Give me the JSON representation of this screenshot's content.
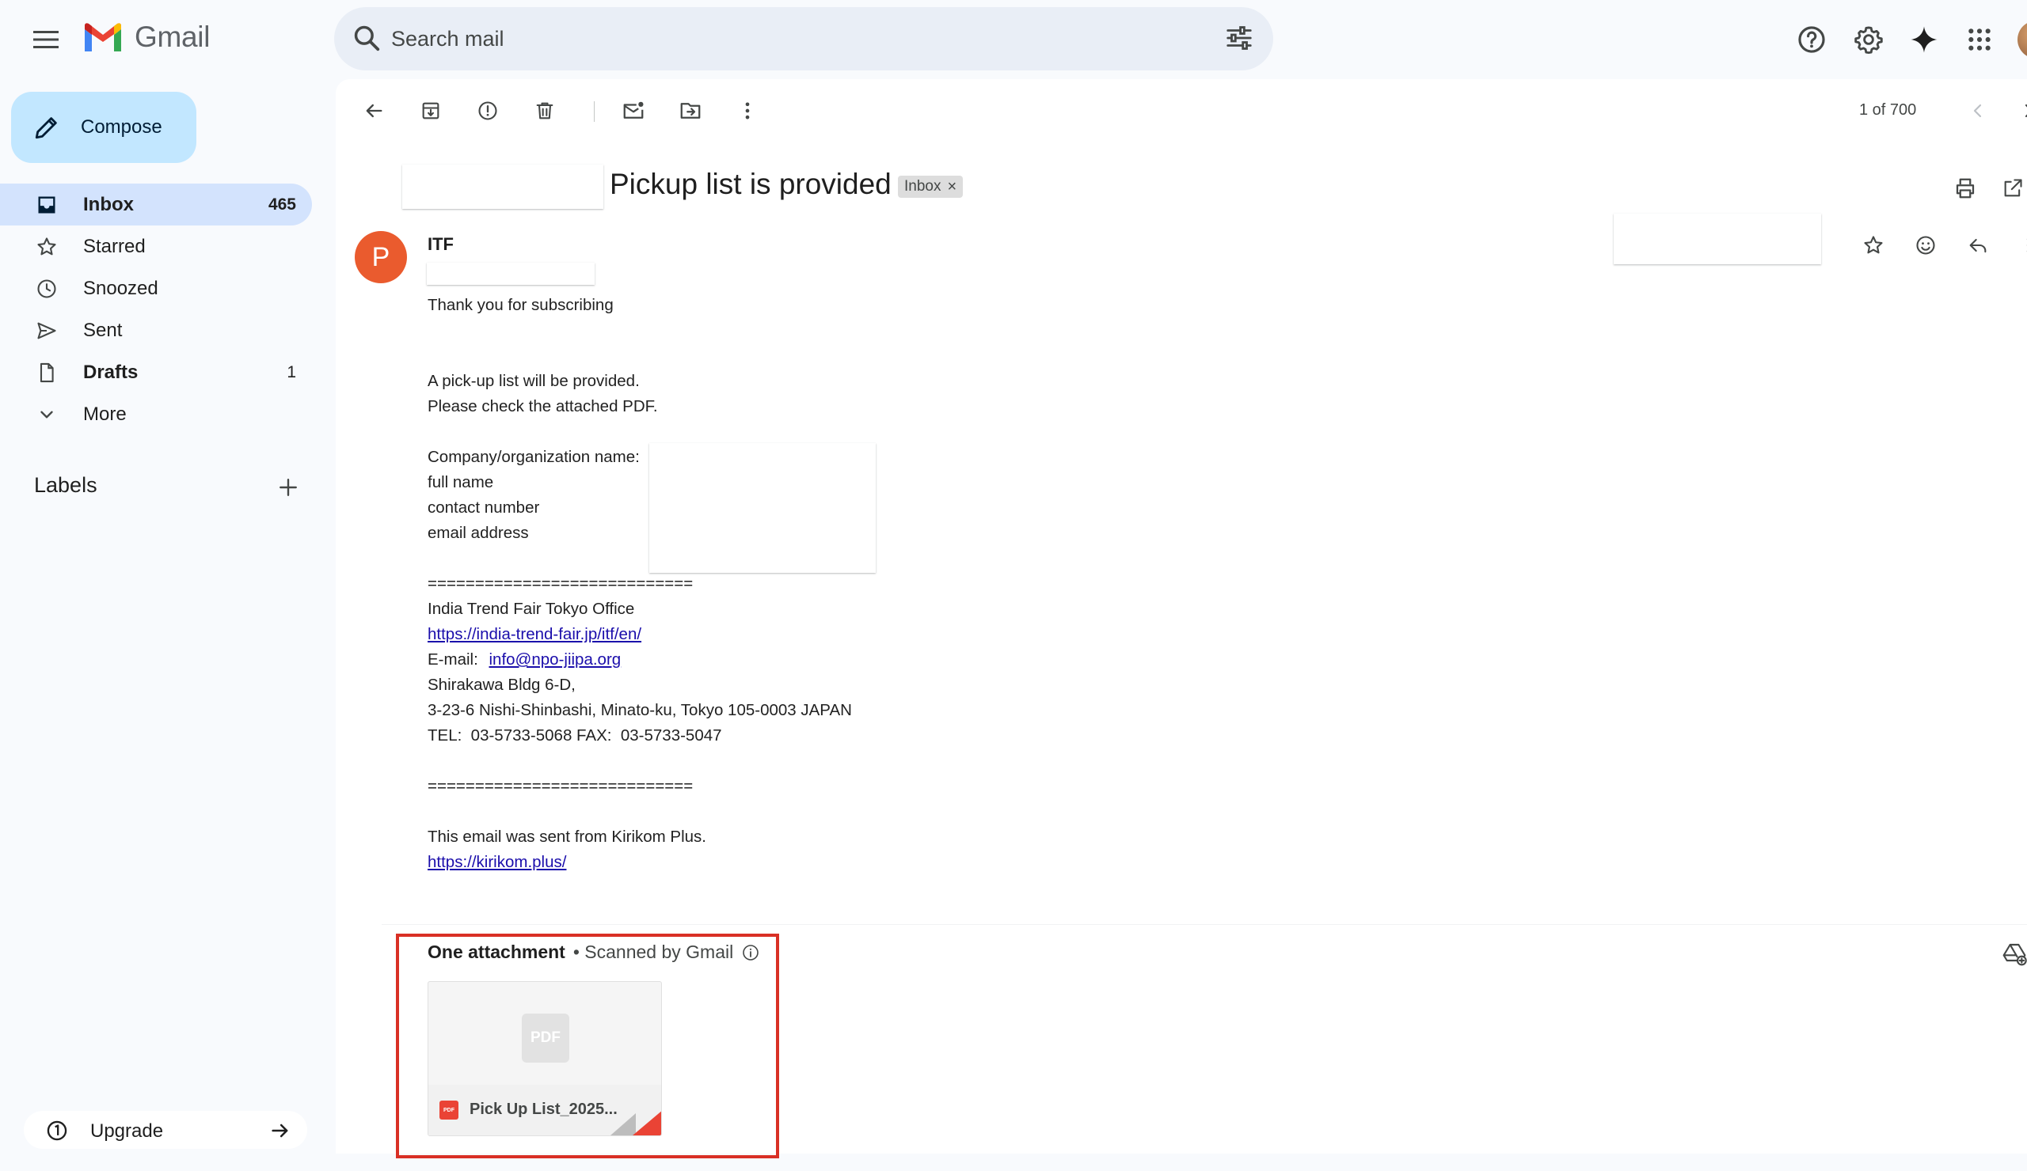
{
  "app": {
    "name": "Gmail"
  },
  "search": {
    "placeholder": "Search mail"
  },
  "sidebar": {
    "compose_label": "Compose",
    "items": [
      {
        "label": "Inbox",
        "count": "465",
        "icon": "inbox-icon"
      },
      {
        "label": "Starred",
        "count": "",
        "icon": "star-icon"
      },
      {
        "label": "Snoozed",
        "count": "",
        "icon": "clock-icon"
      },
      {
        "label": "Sent",
        "count": "",
        "icon": "send-icon"
      },
      {
        "label": "Drafts",
        "count": "1",
        "icon": "draft-icon"
      },
      {
        "label": "More",
        "count": "",
        "icon": "chevron-down-icon"
      }
    ],
    "labels_title": "Labels",
    "upgrade_label": "Upgrade"
  },
  "toolbar": {
    "pager": "1 of 700",
    "icons": [
      "back-arrow-icon",
      "archive-icon",
      "report-spam-icon",
      "delete-icon",
      "mark-unread-icon",
      "move-to-icon",
      "more-vert-icon",
      "prev-icon",
      "next-icon"
    ]
  },
  "email": {
    "subject": "Pickup list is provided",
    "label_chip": "Inbox",
    "chip_close": "×",
    "sender_initial": "P",
    "sender_name": "ITF",
    "body": {
      "greeting": "Thank you for subscribing",
      "para1_line1": "A pick-up list will be provided.",
      "para1_line2": "Please check the attached PDF.",
      "field1": "Company/organization name:",
      "field2": "full name",
      "field3": "contact number",
      "field4": "email address",
      "separator": "============================",
      "org": "India Trend Fair Tokyo Office",
      "org_url": "https://india-trend-fair.jp/itf/en/",
      "email_label": "E-mail:",
      "email_value": "info@npo-jiipa.org",
      "address1": "Shirakawa Bldg 6-D,",
      "address2": "3-23-6 Nishi-Shinbashi, Minato-ku, Tokyo 105-0003 JAPAN",
      "tel": "TEL:  03-5733-5068 FAX:  03-5733-5047",
      "separator2": "============================",
      "footer": "This email was sent from Kirikom Plus.",
      "footer_url": "https://kirikom.plus/"
    }
  },
  "attachments": {
    "title": "One attachment",
    "scanned": "• Scanned by Gmail",
    "thumb_label": "PDF",
    "file_name": "Pick Up List_2025...",
    "file_badge": "PDF"
  },
  "colors": {
    "compose_bg": "#c2e7ff",
    "active_nav": "#d3e3fd",
    "avatar": "#ea5b2e",
    "highlight_box": "#d93025",
    "link": "#1a0dab"
  }
}
